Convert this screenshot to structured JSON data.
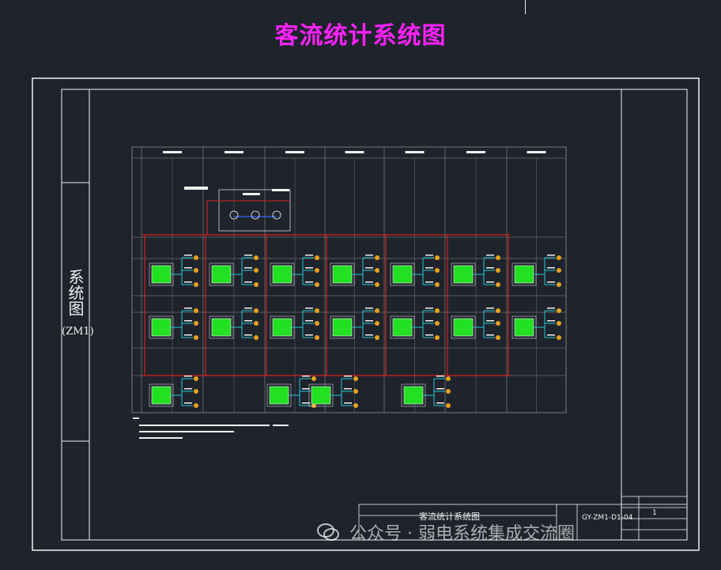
{
  "page": {
    "title": "客流统计系统图"
  },
  "sidebar": {
    "text": "系统图",
    "code": "(ZM1)"
  },
  "title_block": {
    "drawing_name": "客流统计系统图",
    "sheet_value": "1",
    "drawing_no": "GY-ZM1-D1-04"
  },
  "watermark": {
    "text": "公众号 · 弱电系统集成交流圈"
  },
  "colors": {
    "title": "#ff22ff",
    "frame": "#f0f0f0",
    "grid": "#8c8c8c",
    "power_line": "#d42020",
    "signal_line": "#20c8d8",
    "device": "#22e022",
    "camera": "#e8a020",
    "background": "#1f242c"
  }
}
